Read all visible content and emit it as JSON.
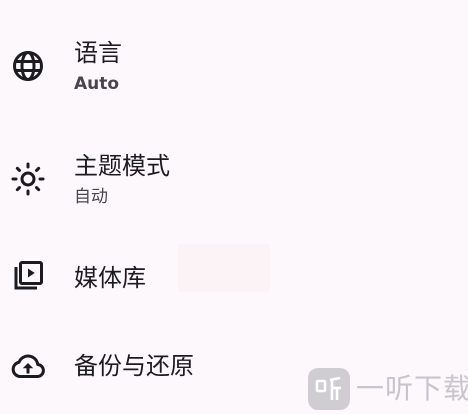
{
  "settings": {
    "items": [
      {
        "id": "language",
        "icon": "globe-icon",
        "title": "语言",
        "subtitle": "Auto"
      },
      {
        "id": "theme",
        "icon": "sun-icon",
        "title": "主题模式",
        "subtitle": "自动"
      },
      {
        "id": "library",
        "icon": "video-library-icon",
        "title": "媒体库"
      },
      {
        "id": "backup",
        "icon": "cloud-upload-icon",
        "title": "备份与还原"
      }
    ]
  },
  "watermark": {
    "text": "一听下载"
  },
  "colors": {
    "background": "#fcf8fc",
    "text_primary": "#1c1b1f",
    "text_secondary": "#49454f",
    "watermark": "#c8c6ca"
  }
}
